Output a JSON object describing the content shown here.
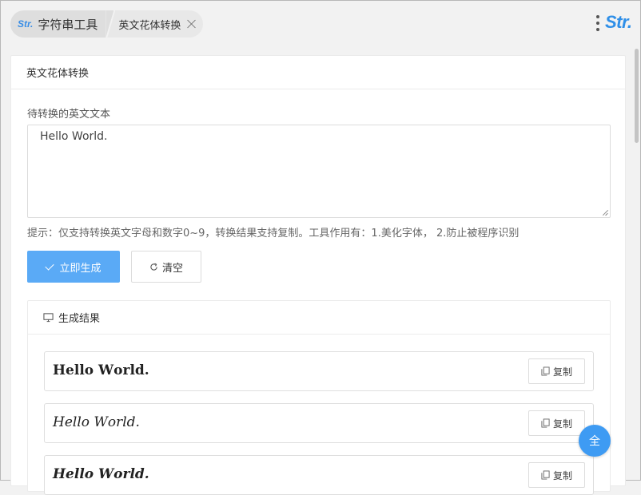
{
  "breadcrumb": {
    "home_logo": "Str.",
    "home_label": "字符串工具",
    "current_label": "英文花体转换"
  },
  "brand": {
    "logo_text": "Str."
  },
  "card": {
    "title": "英文花体转换",
    "input_label": "待转换的英文文本",
    "input_value": "Hello World.",
    "hint": "提示：仅支持转换英文字母和数字0~9，转换结果支持复制。工具作用有：1.美化字体， 2.防止被程序识别",
    "generate_label": "立即生成",
    "clear_label": "清空"
  },
  "result": {
    "title": "生成结果",
    "rows": [
      {
        "text": "𝐇𝐞𝐥𝐥𝐨 𝐖𝐨𝐫𝐥𝐝.",
        "copy_label": "复制"
      },
      {
        "text": "𝐻𝑒𝑙𝑙𝑜 𝑊𝑜𝑟𝑙𝑑.",
        "copy_label": "复制"
      },
      {
        "text": "𝑯𝒆𝒍𝒍𝒐 𝑾𝒐𝒓𝒍𝒅.",
        "copy_label": "复制"
      }
    ]
  },
  "fab": {
    "label": "全"
  },
  "colors": {
    "primary": "#5aaaf6",
    "brand": "#2f8fe8",
    "fab": "#3e9bf3"
  }
}
